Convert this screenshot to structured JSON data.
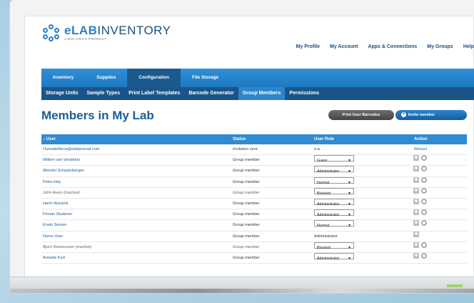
{
  "brand": {
    "name_bold": "eLAB",
    "name_rest": "INVENTORY",
    "tagline": "A BIO-ITECH PRODUCT"
  },
  "topnav": [
    "My Profile",
    "My Account",
    "Apps & Connections",
    "My Groups",
    "Help"
  ],
  "mainnav": [
    {
      "label": "Inventory",
      "active": false
    },
    {
      "label": "Supplies",
      "active": false
    },
    {
      "label": "Configuration",
      "active": true
    },
    {
      "label": "File Storage",
      "active": false
    }
  ],
  "subnav": [
    {
      "label": "Storage Units",
      "active": false
    },
    {
      "label": "Sample Types",
      "active": false
    },
    {
      "label": "Print Label Templates",
      "active": false
    },
    {
      "label": "Barcode Generator",
      "active": false
    },
    {
      "label": "Group Members",
      "active": true
    },
    {
      "label": "Permissions",
      "active": false
    }
  ],
  "page_title": "Members in My Lab",
  "buttons": {
    "print": "Print User Barcodes",
    "invite": "Invite member"
  },
  "table": {
    "headers": {
      "user": "↕ User",
      "status": "Status",
      "role": "User Role",
      "action": "Action"
    },
    "rows": [
      {
        "user": "l.fumadzNeva@elabjournal.com",
        "status": "Invitation sent",
        "role": "n.a.",
        "action": "Retract",
        "type": "invite"
      },
      {
        "user": "Willem van Vendeloo",
        "status": "Group member",
        "role": "Guest",
        "action": "icons",
        "type": "select"
      },
      {
        "user": "Wendel Schaatsbergen",
        "status": "Group member",
        "role": "Administrator",
        "action": "icons",
        "type": "select"
      },
      {
        "user": "Petra Heij",
        "status": "Group member",
        "role": "Normal",
        "action": "icons",
        "type": "select"
      },
      {
        "user": "John Avery (inactive)",
        "status": "Group member",
        "role": "Blocked",
        "action": "icons",
        "type": "select",
        "inactive": true
      },
      {
        "user": "Harm Ruesink",
        "status": "Group member",
        "role": "Administrator",
        "action": "icons",
        "type": "select"
      },
      {
        "user": "Florian Studener",
        "status": "Group member",
        "role": "Administrator",
        "action": "icons",
        "type": "select"
      },
      {
        "user": "Erwin Seinen",
        "status": "Group member",
        "role": "Normal",
        "action": "icons",
        "type": "select"
      },
      {
        "user": "Demo User",
        "status": "Group member",
        "role": "Administrator",
        "action": "user-icon",
        "type": "text"
      },
      {
        "user": "Bjorn Rasmussen (inactive)",
        "status": "Group member",
        "role": "Blocked",
        "action": "icons",
        "type": "select",
        "inactive": true
      },
      {
        "user": "Annette Kort",
        "status": "Group member",
        "role": "Administrator",
        "action": "icons",
        "type": "select"
      }
    ]
  }
}
